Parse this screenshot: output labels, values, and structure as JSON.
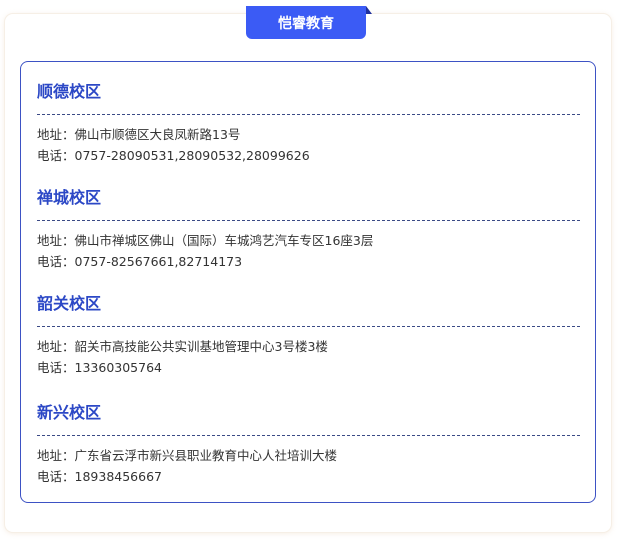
{
  "header": {
    "title": "恺睿教育"
  },
  "campuses": [
    {
      "name": "顺德校区",
      "address_label": "地址：",
      "address": "佛山市顺德区大良凤新路13号",
      "phone_label": "电话：",
      "phone": "0757-28090531,28090532,28099626"
    },
    {
      "name": "禅城校区",
      "address_label": "地址：",
      "address": "佛山市禅城区佛山（国际）车城鸿艺汽车专区16座3层",
      "phone_label": "电话：",
      "phone": "0757-82567661,82714173"
    },
    {
      "name": "韶关校区",
      "address_label": "地址：",
      "address": "韶关市高技能公共实训基地管理中心3号楼3楼",
      "phone_label": "电话：",
      "phone": "13360305764"
    },
    {
      "name": "新兴校区",
      "address_label": "地址：",
      "address": "广东省云浮市新兴县职业教育中心人社培训大楼",
      "phone_label": "电话：",
      "phone": "18938456667"
    }
  ],
  "colors": {
    "accent": "#3b5bf5",
    "campus_title": "#2c48c6",
    "border": "#3d52c4"
  }
}
